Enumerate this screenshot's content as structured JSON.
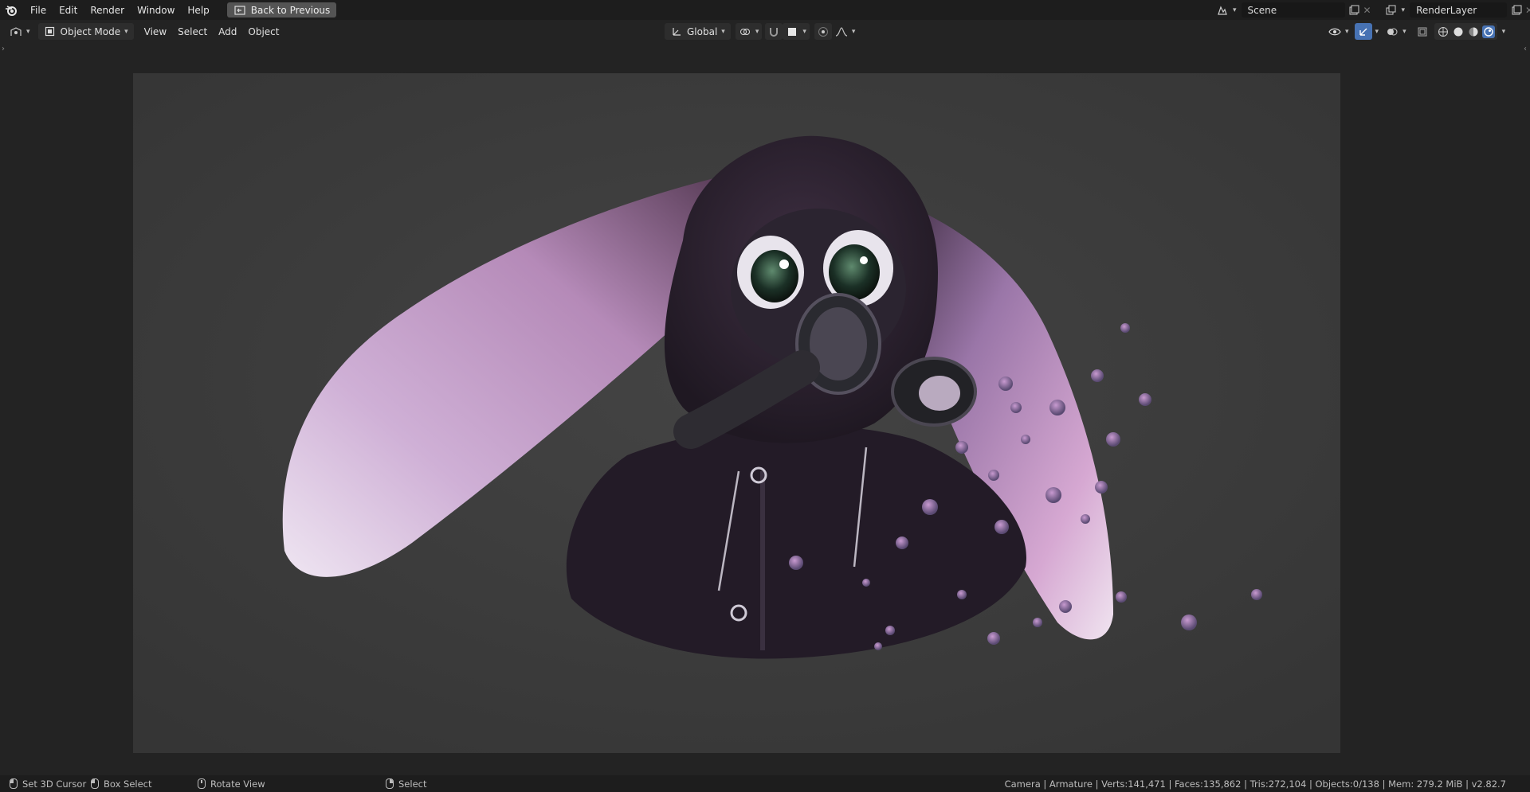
{
  "topbar": {
    "menu": [
      "File",
      "Edit",
      "Render",
      "Window",
      "Help"
    ],
    "back_label": "Back to Previous",
    "scene_value": "Scene",
    "render_layer_value": "RenderLayer"
  },
  "toolbar": {
    "mode_label": "Object Mode",
    "menus": [
      "View",
      "Select",
      "Add",
      "Object"
    ],
    "orientation_label": "Global"
  },
  "statusbar": {
    "set_cursor": "Set 3D Cursor",
    "box_select": "Box Select",
    "rotate_view": "Rotate View",
    "select": "Select",
    "stats": "Camera | Armature | Verts:141,471 | Faces:135,862 | Tris:272,104 | Objects:0/138 | Mem: 279.2 MiB | v2.82.7"
  },
  "icons": {
    "app": "blender-logo-icon",
    "accent": "#4772b3"
  }
}
